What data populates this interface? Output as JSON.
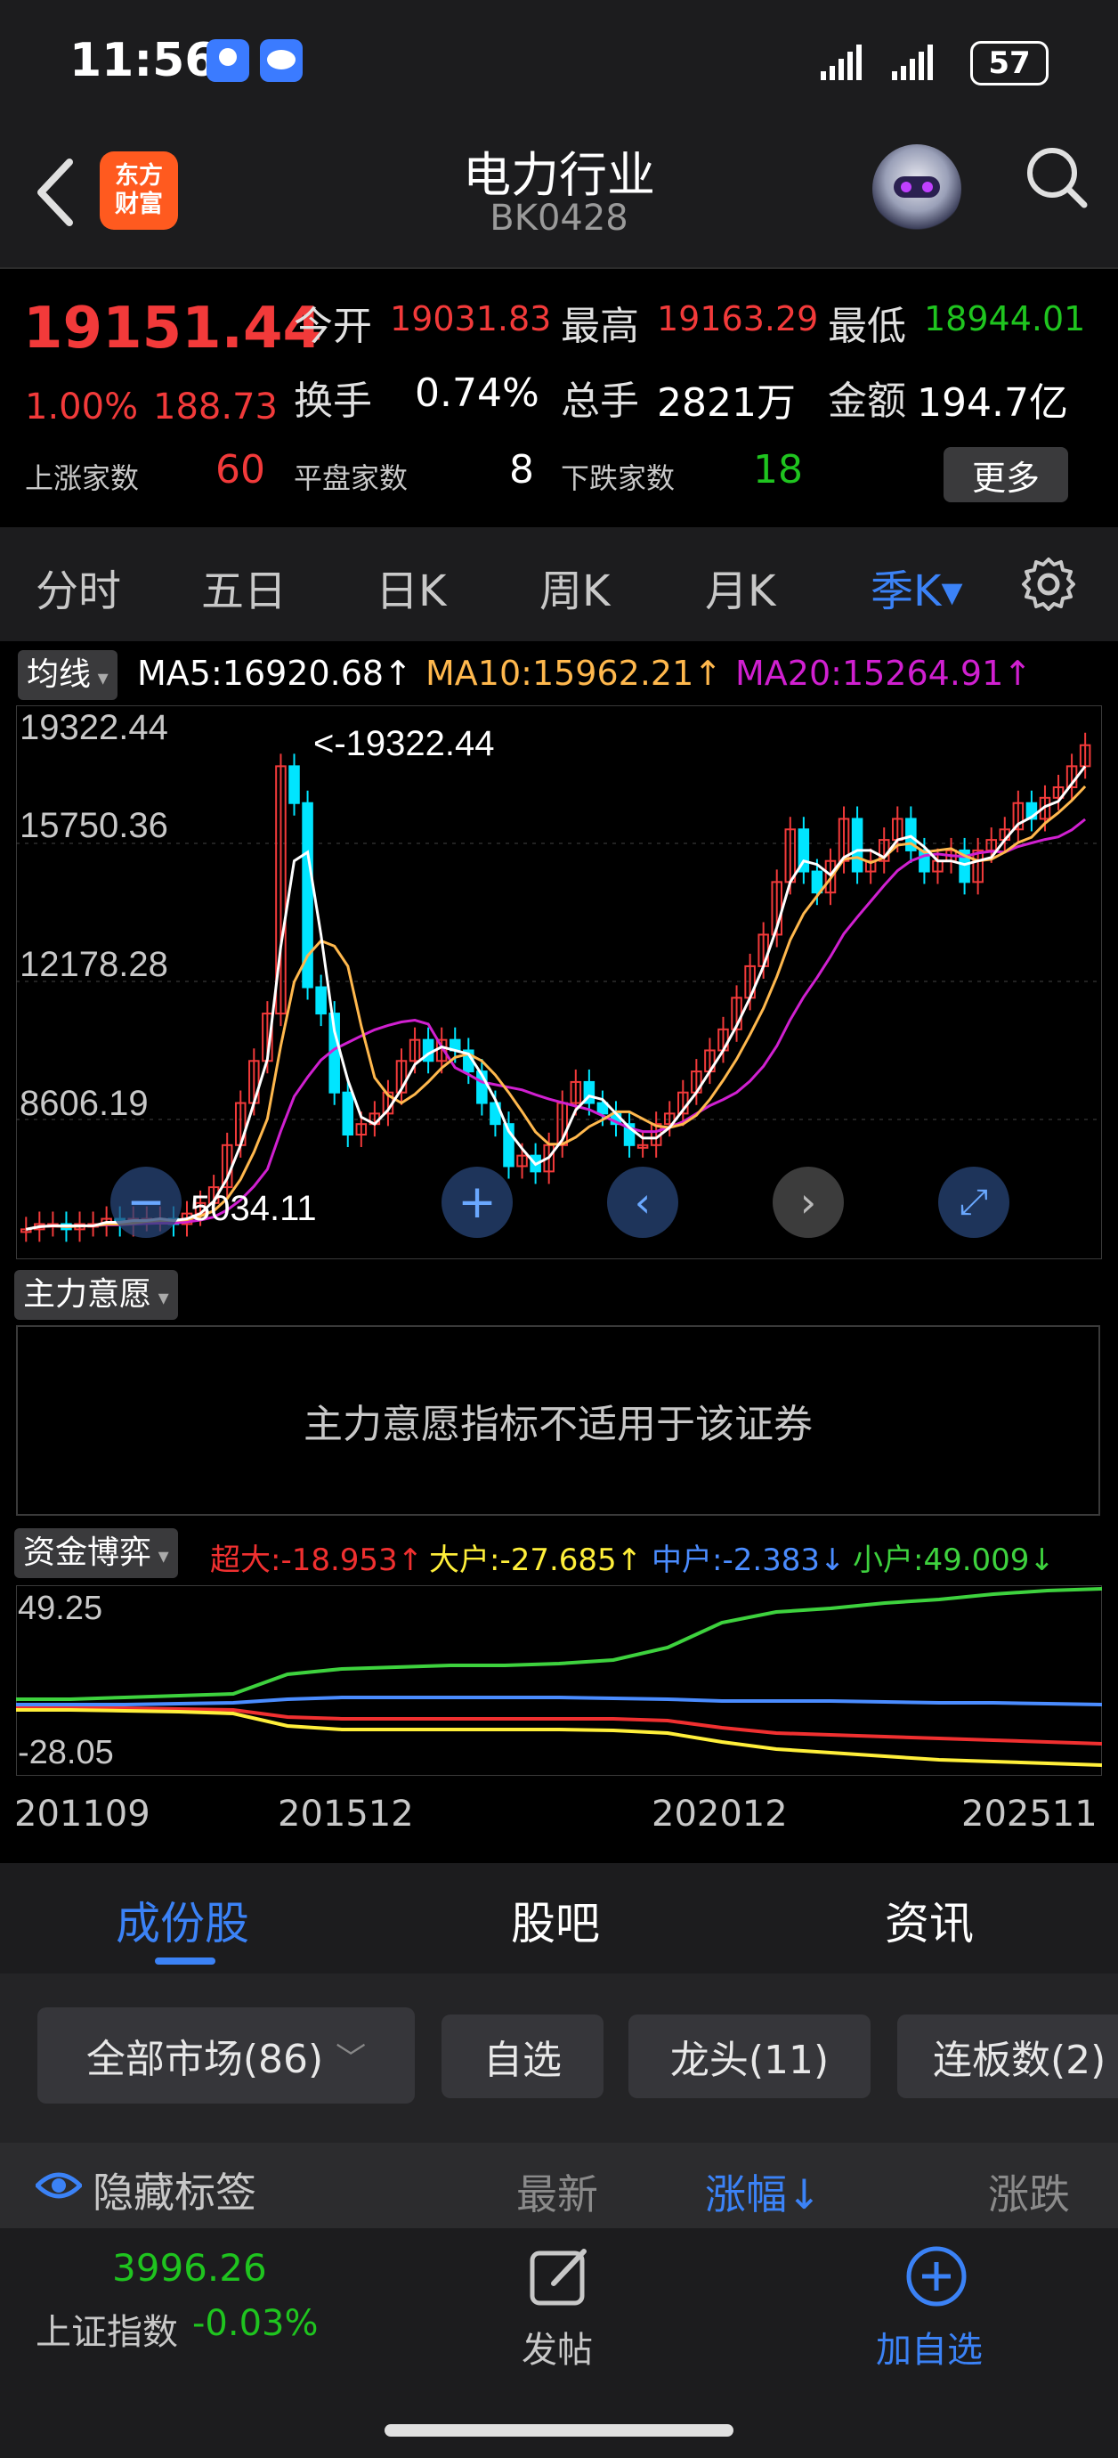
{
  "status_bar": {
    "time": "11:56",
    "battery": "57"
  },
  "header": {
    "logo_text_line1": "东方",
    "logo_text_line2": "财富",
    "title": "电力行业",
    "code": "BK0428"
  },
  "quote": {
    "price": "19151.44",
    "change_pct": "1.00%",
    "change_amt": "188.73",
    "open_label": "今开",
    "open": "19031.83",
    "high_label": "最高",
    "high": "19163.29",
    "low_label": "最低",
    "low": "18944.01",
    "turnover_label": "换手",
    "turnover": "0.74%",
    "volume_label": "总手",
    "volume": "2821万",
    "amount_label": "金额",
    "amount": "194.7亿",
    "up_label": "上涨家数",
    "up_count": "60",
    "flat_label": "平盘家数",
    "flat_count": "8",
    "down_label": "下跌家数",
    "down_count": "18",
    "more_label": "更多"
  },
  "period_tabs": [
    "分时",
    "五日",
    "日K",
    "周K",
    "月K",
    "季K▾"
  ],
  "ma_legend": {
    "tag": "均线",
    "ma5": "MA5:16920.68↑",
    "ma10": "MA10:15962.21↑",
    "ma20": "MA20:15264.91↑"
  },
  "price_axis": [
    "19322.44",
    "15750.36",
    "12178.28",
    "8606.19"
  ],
  "high_marker": "<-19322.44",
  "low_marker": "5034.11",
  "indicator1": {
    "tag": "主力意愿",
    "message": "主力意愿指标不适用于该证券"
  },
  "indicator2": {
    "tag": "资金博弈",
    "super": "超大:-18.953↑",
    "large": "大户:-27.685↑",
    "medium": "中户:-2.383↓",
    "small": "小户:49.009↓",
    "ymax": "49.25",
    "ymin": "-28.05"
  },
  "x_axis": [
    "201109",
    "201512",
    "202012",
    "202511"
  ],
  "colors": {
    "up": "#f23a3a",
    "down": "#00e5ff",
    "ma5": "#ffffff",
    "ma10": "#ffb84d",
    "ma20": "#d020d0",
    "super": "#f03030",
    "large": "#ffef3a",
    "medium": "#4a8cff",
    "small": "#3ed23e",
    "accent": "#3b82f6"
  },
  "bottom_tabs": [
    "成份股",
    "股吧",
    "资讯"
  ],
  "filters": [
    "全部市场(86)",
    "自选",
    "龙头(11)",
    "连板数(2)"
  ],
  "list_header": {
    "hide_label": "隐藏标签",
    "latest": "最新",
    "change": "涨幅↓",
    "change_amt": "涨跌"
  },
  "footer": {
    "index_value": "3996.26",
    "index_name": "上证指数",
    "index_change": "-0.03%",
    "post_label": "发帖",
    "add_label": "加自选"
  }
}
